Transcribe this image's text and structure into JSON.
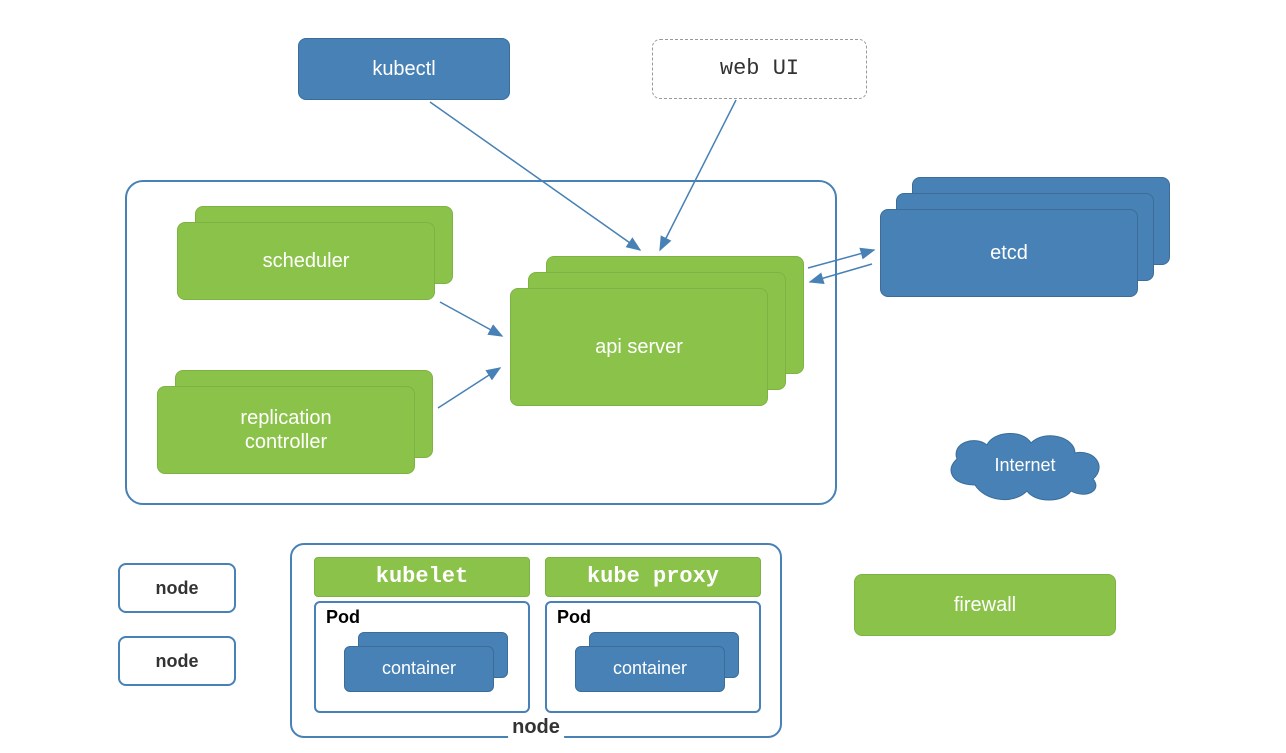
{
  "top": {
    "kubectl": "kubectl",
    "webui": "web UI"
  },
  "master": {
    "scheduler": "scheduler",
    "replication_controller": "replication\ncontroller",
    "api_server": "api server"
  },
  "etcd": "etcd",
  "internet": "Internet",
  "firewall": "firewall",
  "node_small_1": "node",
  "node_small_2": "node",
  "node_big": {
    "kubelet": "kubelet",
    "kube_proxy": "kube proxy",
    "pod": "Pod",
    "container": "container",
    "node_label": "node"
  }
}
